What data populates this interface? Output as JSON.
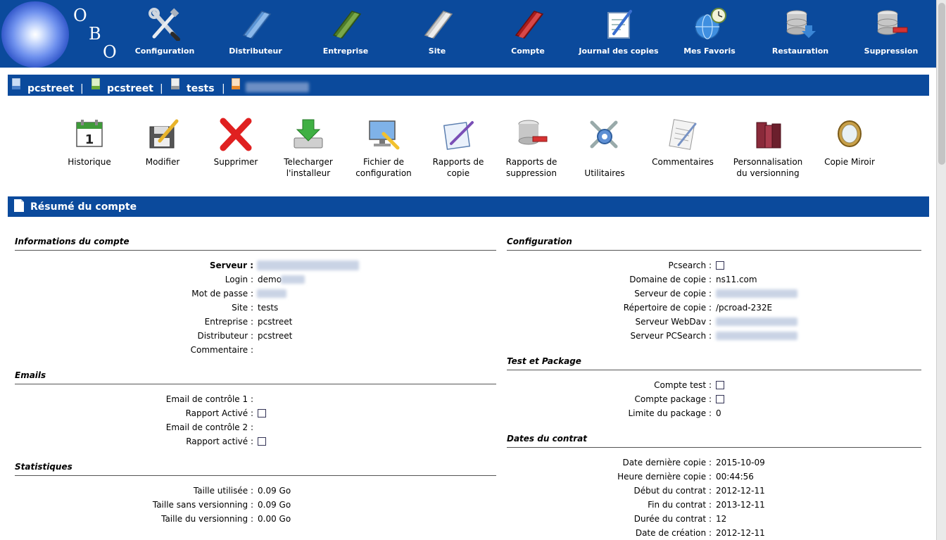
{
  "logo": {
    "letters": [
      "O",
      "B",
      "O"
    ]
  },
  "nav": [
    {
      "label": "Configuration",
      "icon": "tools-icon"
    },
    {
      "label": "Distributeur",
      "icon": "blue-folder-icon"
    },
    {
      "label": "Entreprise",
      "icon": "green-folder-icon"
    },
    {
      "label": "Site",
      "icon": "gray-folder-icon"
    },
    {
      "label": "Compte",
      "icon": "red-folder-icon"
    },
    {
      "label": "Journal des copies",
      "icon": "journal-icon"
    },
    {
      "label": "Mes Favoris",
      "icon": "globe-clock-icon"
    },
    {
      "label": "Restauration",
      "icon": "database-download-icon"
    },
    {
      "label": "Suppression",
      "icon": "database-remove-icon"
    }
  ],
  "breadcrumb": [
    {
      "label": "pcstreet",
      "icon": "blue-doc-icon"
    },
    {
      "label": "pcstreet",
      "icon": "green-doc-icon"
    },
    {
      "label": "tests",
      "icon": "gray-doc-icon"
    },
    {
      "label": "",
      "icon": "orange-doc-icon"
    }
  ],
  "breadcrumb_separator": "|",
  "actions": [
    {
      "label": "Historique",
      "icon": "calendar-icon"
    },
    {
      "label": "Modifier",
      "icon": "edit-floppy-icon"
    },
    {
      "label": "Supprimer",
      "icon": "red-x-icon"
    },
    {
      "label": "Telecharger\nl'installeur",
      "icon": "download-drive-icon"
    },
    {
      "label": "Fichier de\nconfiguration",
      "icon": "config-screen-icon"
    },
    {
      "label": "Rapports de\ncopie",
      "icon": "report-pen-icon"
    },
    {
      "label": "Rapports de\nsuppression",
      "icon": "database-delete-icon"
    },
    {
      "label": "Utilitaires",
      "icon": "utilities-gear-icon"
    },
    {
      "label": "Commentaires",
      "icon": "notepad-icon"
    },
    {
      "label": "Personnalisation\ndu versionning",
      "icon": "books-icon"
    },
    {
      "label": "Copie Miroir",
      "icon": "mirror-icon"
    }
  ],
  "section_title": "Résumé du compte",
  "left": {
    "info": {
      "title": "Informations du compte",
      "rows": [
        {
          "label": "Serveur :",
          "value": "",
          "bold": true
        },
        {
          "label": "Login :",
          "value": "demo"
        },
        {
          "label": "Mot de passe :",
          "value": ""
        },
        {
          "label": "Site :",
          "value": "tests"
        },
        {
          "label": "Entreprise :",
          "value": "pcstreet"
        },
        {
          "label": "Distributeur :",
          "value": "pcstreet"
        },
        {
          "label": "Commentaire :",
          "value": ""
        }
      ]
    },
    "emails": {
      "title": "Emails",
      "rows": [
        {
          "label": "Email de contrôle 1 :",
          "value": ""
        },
        {
          "label": "Rapport Activé :",
          "checkbox": true,
          "checked": false
        },
        {
          "label": "Email de contrôle 2 :",
          "value": ""
        },
        {
          "label": "Rapport activé :",
          "checkbox": true,
          "checked": false
        }
      ]
    },
    "stats": {
      "title": "Statistiques",
      "rows": [
        {
          "label": "Taille utilisée :",
          "value": "0.09 Go"
        },
        {
          "label": "Taille sans versionning :",
          "value": "0.09 Go"
        },
        {
          "label": "Taille du versionning :",
          "value": "0.00 Go"
        }
      ]
    }
  },
  "right": {
    "config": {
      "title": "Configuration",
      "rows": [
        {
          "label": "Pcsearch :",
          "checkbox": true,
          "checked": false
        },
        {
          "label": "Domaine de copie :",
          "value": "ns11.com"
        },
        {
          "label": "Serveur de copie :",
          "value": ""
        },
        {
          "label": "Répertoire de copie :",
          "value": "/pcroad-232E"
        },
        {
          "label": "Serveur WebDav :",
          "value": ""
        },
        {
          "label": "Serveur PCSearch :",
          "value": ""
        }
      ]
    },
    "test": {
      "title": "Test et Package",
      "rows": [
        {
          "label": "Compte test :",
          "checkbox": true,
          "checked": false
        },
        {
          "label": "Compte package :",
          "checkbox": true,
          "checked": false
        },
        {
          "label": "Limite du package :",
          "value": "0"
        }
      ]
    },
    "dates": {
      "title": "Dates du contrat",
      "rows": [
        {
          "label": "Date dernière copie :",
          "value": "2015-10-09"
        },
        {
          "label": "Heure dernière copie :",
          "value": "00:44:56"
        },
        {
          "label": "Début du contrat :",
          "value": "2012-12-11"
        },
        {
          "label": "Fin du contrat :",
          "value": "2013-12-11"
        },
        {
          "label": "Durée du contrat :",
          "value": "12"
        },
        {
          "label": "Date de création :",
          "value": "2012-12-11"
        }
      ]
    }
  },
  "colors": {
    "banner": "#0b4a9c",
    "text": "#000000",
    "label_text": "#ffffff"
  }
}
